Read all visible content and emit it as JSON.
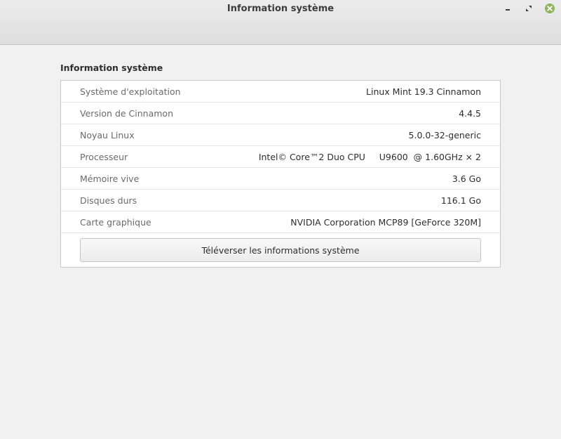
{
  "window": {
    "title": "Information système",
    "buttons": {
      "minimize_icon": "minimize-icon",
      "maximize_icon": "maximize-icon",
      "close_icon": "close-icon"
    },
    "close_color": "#8fb45f"
  },
  "section": {
    "title": "Information système"
  },
  "info_rows": [
    {
      "label": "Système d'exploitation",
      "value": "Linux Mint 19.3 Cinnamon"
    },
    {
      "label": "Version de Cinnamon",
      "value": "4.4.5"
    },
    {
      "label": "Noyau Linux",
      "value": "5.0.0-32-generic"
    },
    {
      "label": "Processeur",
      "value": "Intel© Core™2 Duo CPU     U9600  @ 1.60GHz × 2"
    },
    {
      "label": "Mémoire vive",
      "value": "3.6 Go"
    },
    {
      "label": "Disques durs",
      "value": "116.1 Go"
    },
    {
      "label": "Carte graphique",
      "value": "NVIDIA Corporation MCP89 [GeForce 320M]"
    }
  ],
  "upload_button": {
    "label": "Téléverser les informations système"
  }
}
